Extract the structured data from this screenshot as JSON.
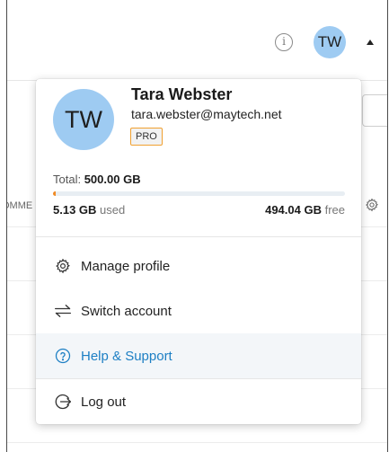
{
  "topbar": {
    "info_icon": "info-icon",
    "avatar_initials": "TW",
    "menu_caret": "caret-up-icon"
  },
  "background": {
    "column_header_fragment": "OMME",
    "settings_icon": "gear-icon"
  },
  "profile": {
    "avatar_initials": "TW",
    "name": "Tara Webster",
    "email": "tara.webster@maytech.net",
    "plan_badge": "PRO"
  },
  "storage": {
    "total_label": "Total:",
    "total_value": "500.00 GB",
    "used_value": "5.13 GB",
    "used_label": "used",
    "free_value": "494.04 GB",
    "free_label": "free",
    "used_fraction": 0.0103,
    "bar_color": "#f08a24"
  },
  "menu": [
    {
      "label": "Manage profile",
      "icon": "gear-icon"
    },
    {
      "label": "Switch account",
      "icon": "switch-arrows-icon"
    },
    {
      "label": "Help & Support",
      "icon": "help-circle-icon",
      "highlighted": true
    },
    {
      "label": "Log out",
      "icon": "logout-icon"
    }
  ],
  "colors": {
    "avatar_bg": "#9ecbf2",
    "help_link": "#1d7fc4",
    "pro_border": "#f0a030"
  }
}
